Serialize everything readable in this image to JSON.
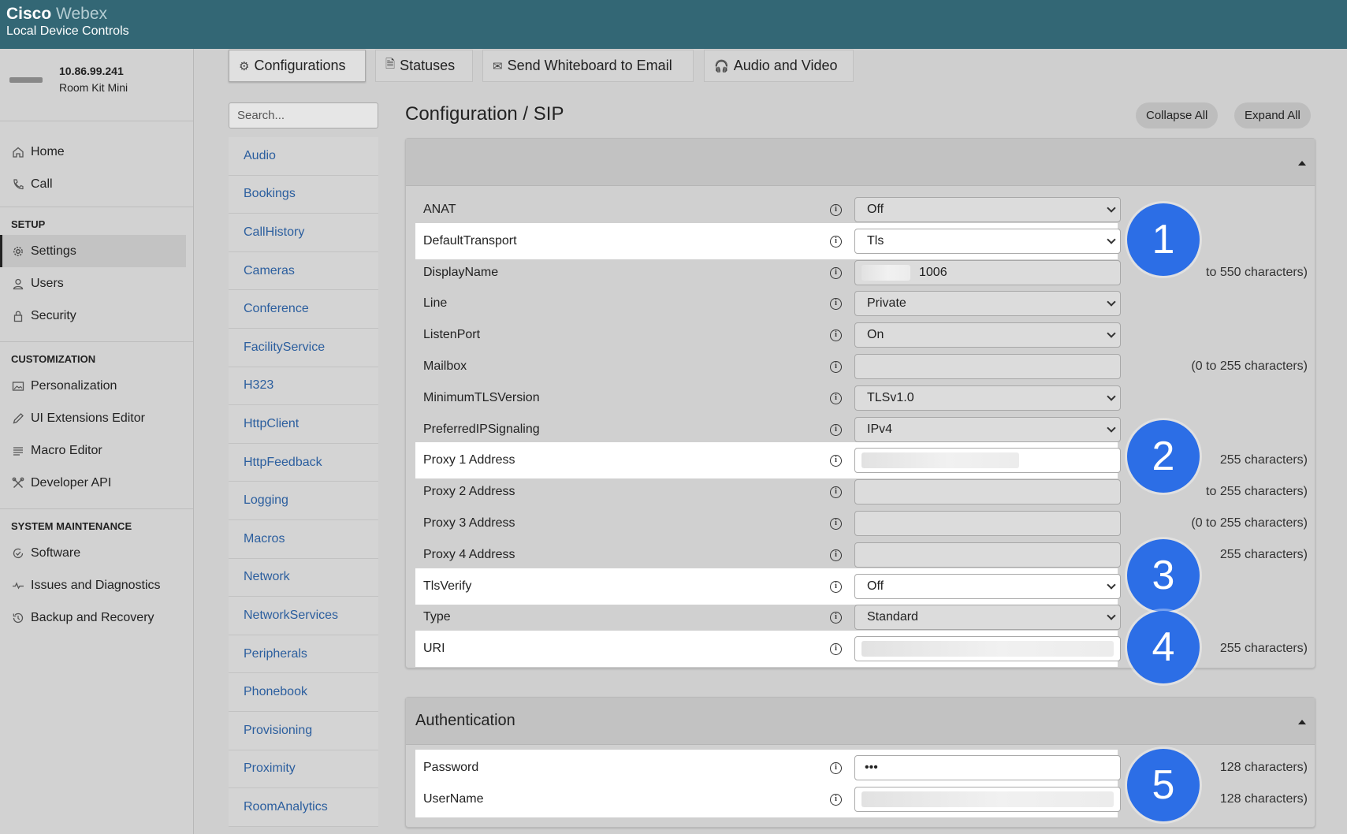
{
  "header": {
    "brand_bold": "Cisco",
    "brand_light": "Webex",
    "subtitle": "Local Device Controls"
  },
  "device": {
    "ip": "10.86.99.241",
    "model": "Room Kit Mini"
  },
  "sidebar": {
    "top_items": [
      {
        "label": "Home",
        "icon": "home-icon"
      },
      {
        "label": "Call",
        "icon": "phone-icon"
      }
    ],
    "sections": [
      {
        "heading": "SETUP",
        "items": [
          {
            "label": "Settings",
            "icon": "gear-icon",
            "active": true
          },
          {
            "label": "Users",
            "icon": "user-icon"
          },
          {
            "label": "Security",
            "icon": "lock-icon"
          }
        ]
      },
      {
        "heading": "CUSTOMIZATION",
        "items": [
          {
            "label": "Personalization",
            "icon": "image-icon"
          },
          {
            "label": "UI Extensions Editor",
            "icon": "pencil-icon"
          },
          {
            "label": "Macro Editor",
            "icon": "lines-icon"
          },
          {
            "label": "Developer API",
            "icon": "tools-icon"
          }
        ]
      },
      {
        "heading": "SYSTEM MAINTENANCE",
        "items": [
          {
            "label": "Software",
            "icon": "refresh-check-icon"
          },
          {
            "label": "Issues and Diagnostics",
            "icon": "pulse-icon"
          },
          {
            "label": "Backup and Recovery",
            "icon": "history-icon"
          }
        ]
      }
    ]
  },
  "tabs": [
    {
      "label": "Configurations",
      "icon": "gear-icon",
      "active": true
    },
    {
      "label": "Statuses",
      "icon": "document-icon"
    },
    {
      "label": "Send Whiteboard to Email",
      "icon": "mail-icon"
    },
    {
      "label": "Audio and Video",
      "icon": "av-icon"
    }
  ],
  "search": {
    "placeholder": "Search..."
  },
  "categories": [
    "Audio",
    "Bookings",
    "CallHistory",
    "Cameras",
    "Conference",
    "FacilityService",
    "H323",
    "HttpClient",
    "HttpFeedback",
    "Logging",
    "Macros",
    "Network",
    "NetworkServices",
    "Peripherals",
    "Phonebook",
    "Provisioning",
    "Proximity",
    "RoomAnalytics"
  ],
  "main": {
    "title": "Configuration / SIP",
    "collapse_all": "Collapse All",
    "expand_all": "Expand All"
  },
  "sip_settings": [
    {
      "label": "ANAT",
      "type": "select",
      "value": "Off",
      "hint": "",
      "highlight": false
    },
    {
      "label": "DefaultTransport",
      "type": "select",
      "value": "Tls",
      "hint": "",
      "highlight": true
    },
    {
      "label": "DisplayName",
      "type": "text",
      "value": "1006",
      "blurred_prefix": true,
      "hint": "to 550 characters)",
      "highlight": false
    },
    {
      "label": "Line",
      "type": "select",
      "value": "Private",
      "hint": "",
      "highlight": false
    },
    {
      "label": "ListenPort",
      "type": "select",
      "value": "On",
      "hint": "",
      "highlight": false
    },
    {
      "label": "Mailbox",
      "type": "text",
      "value": "",
      "hint": "(0 to 255 characters)",
      "highlight": false
    },
    {
      "label": "MinimumTLSVersion",
      "type": "select",
      "value": "TLSv1.0",
      "hint": "",
      "highlight": false
    },
    {
      "label": "PreferredIPSignaling",
      "type": "select",
      "value": "IPv4",
      "hint": "",
      "highlight": false
    },
    {
      "label": "Proxy 1 Address",
      "type": "text",
      "value": "",
      "blurred": true,
      "hint": "255 characters)",
      "highlight": true
    },
    {
      "label": "Proxy 2 Address",
      "type": "text",
      "value": "",
      "hint": "to 255 characters)",
      "highlight": false
    },
    {
      "label": "Proxy 3 Address",
      "type": "text",
      "value": "",
      "hint": "(0 to 255 characters)",
      "highlight": false
    },
    {
      "label": "Proxy 4 Address",
      "type": "text",
      "value": "",
      "hint": "255 characters)",
      "highlight": false
    },
    {
      "label": "TlsVerify",
      "type": "select",
      "value": "Off",
      "hint": "",
      "highlight": true
    },
    {
      "label": "Type",
      "type": "select",
      "value": "Standard",
      "hint": "",
      "highlight": false
    },
    {
      "label": "URI",
      "type": "text",
      "value": "",
      "blurred": true,
      "hint": "255 characters)",
      "highlight": true
    }
  ],
  "auth_panel": {
    "title": "Authentication",
    "rows": [
      {
        "label": "Password",
        "type": "text",
        "value": "•••",
        "hint": "128 characters)",
        "highlight": true
      },
      {
        "label": "UserName",
        "type": "text",
        "value": "",
        "blurred": true,
        "hint": "128 characters)",
        "highlight": true
      }
    ]
  },
  "badges": [
    "1",
    "2",
    "3",
    "4",
    "5"
  ],
  "colors": {
    "header": "#336775",
    "badge": "#2c6ee6",
    "link": "#2b5e9e"
  }
}
